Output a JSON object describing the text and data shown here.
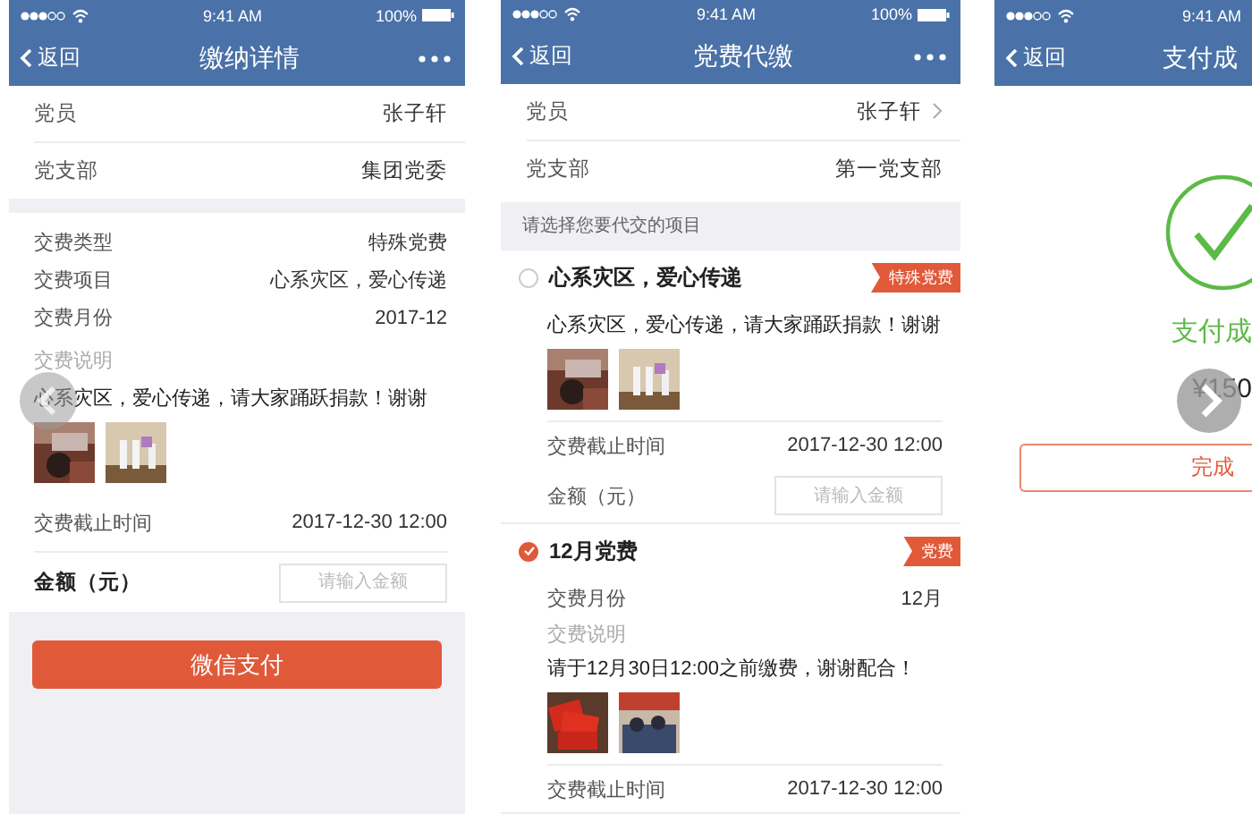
{
  "phones": [
    {
      "kind": "detail",
      "status": {
        "time": "9:41 AM",
        "battery": "100%"
      },
      "nav": {
        "back": "返回",
        "title": "缴纳详情",
        "more": true
      },
      "info": [
        {
          "label": "党员",
          "value": "张子轩",
          "chevron": false
        },
        {
          "label": "党支部",
          "value": "集团党委",
          "chevron": false
        }
      ],
      "fields": [
        {
          "label": "交费类型",
          "value": "特殊党费"
        },
        {
          "label": "交费项目",
          "value": "心系灾区，爱心传递"
        },
        {
          "label": "交费月份",
          "value": "2017-12"
        }
      ],
      "note_label": "交费说明",
      "note": "心系灾区，爱心传递，请大家踊跃捐款！谢谢",
      "photos": [
        {
          "kind": "picture"
        },
        {
          "kind": "picture"
        }
      ],
      "deadline": {
        "label": "交费截止时间",
        "value": "2017-12-30 12:00"
      },
      "amount": {
        "label": "金额（元）",
        "placeholder": "请输入金额"
      },
      "pay_button": "微信支付"
    },
    {
      "kind": "proxy",
      "status": {
        "time": "9:41 AM",
        "battery": "100%"
      },
      "nav": {
        "back": "返回",
        "title": "党费代缴",
        "more": true
      },
      "info": [
        {
          "label": "党员",
          "value": "张子轩",
          "chevron": true
        },
        {
          "label": "党支部",
          "value": "第一党支部",
          "chevron": false
        }
      ],
      "section_header": "请选择您要代交的项目",
      "items": [
        {
          "title": "心系灾区，爱心传递",
          "tag": "特殊党费",
          "selected": false,
          "note": "心系灾区，爱心传递，请大家踊跃捐款！谢谢",
          "photos": [
            {
              "kind": "picture"
            },
            {
              "kind": "picture"
            }
          ],
          "deadline": {
            "label": "交费截止时间",
            "value": "2017-12-30 12:00"
          },
          "amount": {
            "label": "金额（元）",
            "placeholder": "请输入金额"
          }
        },
        {
          "title": "12月党费",
          "tag": "党费",
          "selected": true,
          "fields": [
            {
              "label": "交费月份",
              "value": "12月"
            }
          ],
          "note_label": "交费说明",
          "note": "请于12月30日12:00之前缴费，谢谢配合！",
          "photos": [
            {
              "kind": "picture"
            },
            {
              "kind": "picture"
            }
          ],
          "deadline": {
            "label": "交费截止时间",
            "value": "2017-12-30 12:00"
          }
        }
      ]
    },
    {
      "kind": "success",
      "status": {
        "time": "9:41 AM"
      },
      "nav": {
        "back": "返回",
        "title": "支付成"
      },
      "message": "支付成",
      "amount": "¥150",
      "done_button": "完成"
    }
  ]
}
